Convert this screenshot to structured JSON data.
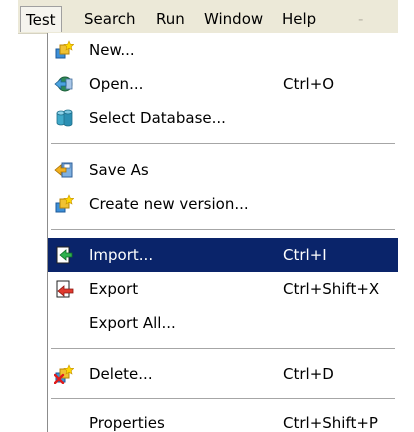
{
  "menubar": {
    "items": [
      {
        "label": "Test",
        "active": true
      },
      {
        "label": "Search"
      },
      {
        "label": "Run"
      },
      {
        "label": "Window"
      },
      {
        "label": "Help"
      }
    ]
  },
  "menu": {
    "new": {
      "label": "New...",
      "icon": "new-test-icon"
    },
    "open": {
      "label": "Open...",
      "shortcut": "Ctrl+O",
      "icon": "open-icon"
    },
    "select_database": {
      "label": "Select Database...",
      "icon": "database-icon"
    },
    "save_as": {
      "label": "Save As",
      "icon": "save-as-icon"
    },
    "create_new_version": {
      "label": "Create new version...",
      "icon": "new-version-icon"
    },
    "import": {
      "label": "Import...",
      "shortcut": "Ctrl+I",
      "icon": "import-icon",
      "highlighted": true
    },
    "export": {
      "label": "Export",
      "shortcut": "Ctrl+Shift+X",
      "icon": "export-icon"
    },
    "export_all": {
      "label": "Export All..."
    },
    "delete": {
      "label": "Delete...",
      "shortcut": "Ctrl+D",
      "icon": "delete-icon"
    },
    "properties": {
      "label": "Properties",
      "shortcut": "Ctrl+Shift+P"
    }
  },
  "colors": {
    "menubar_bg": "#ece9d8",
    "highlight_bg": "#0a246a",
    "highlight_text": "#ffffff"
  }
}
